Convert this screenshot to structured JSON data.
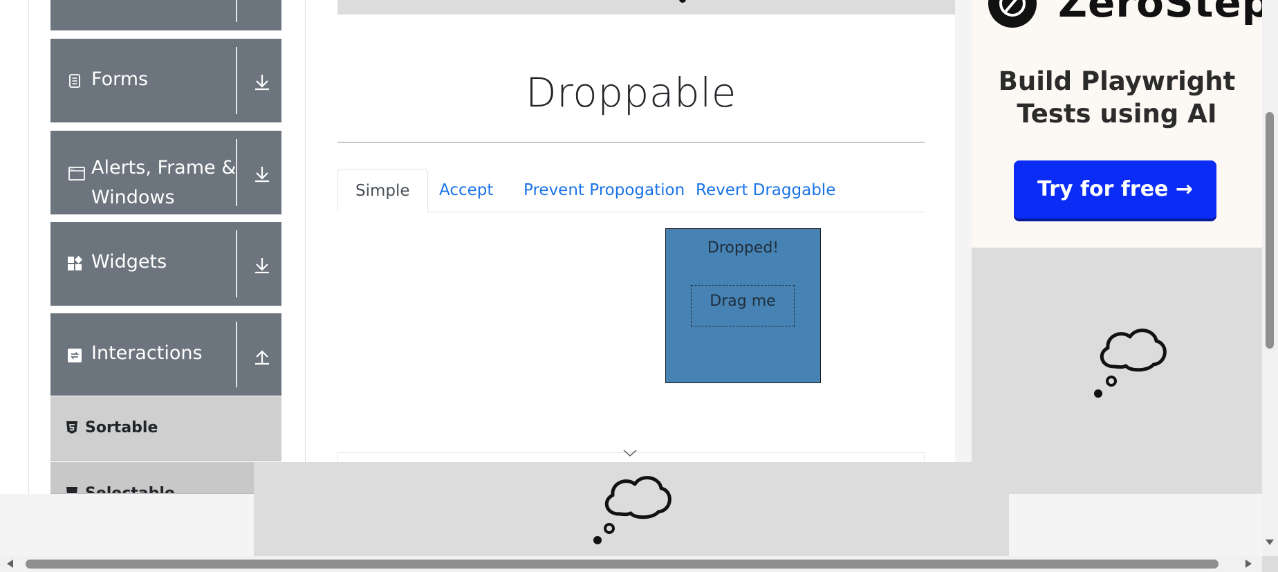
{
  "sidebar": {
    "groups": [
      {
        "label": ""
      },
      {
        "label": "Forms"
      },
      {
        "label": "Alerts, Frame &",
        "label2": "Windows"
      },
      {
        "label": "Widgets"
      },
      {
        "label": "Interactions"
      }
    ],
    "items": [
      {
        "label": "Sortable"
      },
      {
        "label": "Selectable"
      }
    ]
  },
  "main": {
    "title": "Droppable",
    "tabs": [
      {
        "label": "Simple",
        "active": true
      },
      {
        "label": "Accept",
        "active": false
      },
      {
        "label": "Prevent Propogation",
        "active": false
      },
      {
        "label": "Revert Draggable",
        "active": false
      }
    ],
    "droppable": {
      "label": "Dropped!",
      "color": "#4682b4"
    },
    "draggable": {
      "label": "Drag me"
    }
  },
  "ad": {
    "brand": "ZeroStep",
    "headline_line1": "Build Playwright",
    "headline_line2": "Tests using AI",
    "cta": "Try for free →",
    "cta_color": "#0b2cf5"
  },
  "icons": {
    "forms": "document-icon",
    "alerts": "window-icon",
    "widgets": "widgets-grid-icon",
    "interactions": "arrows-cycle-icon",
    "collapsed": "arrow-down-icon",
    "expanded": "arrow-up-icon",
    "sub_items": "html5-shield-icon",
    "ad_placeholder": "thought-bubble-icon"
  }
}
